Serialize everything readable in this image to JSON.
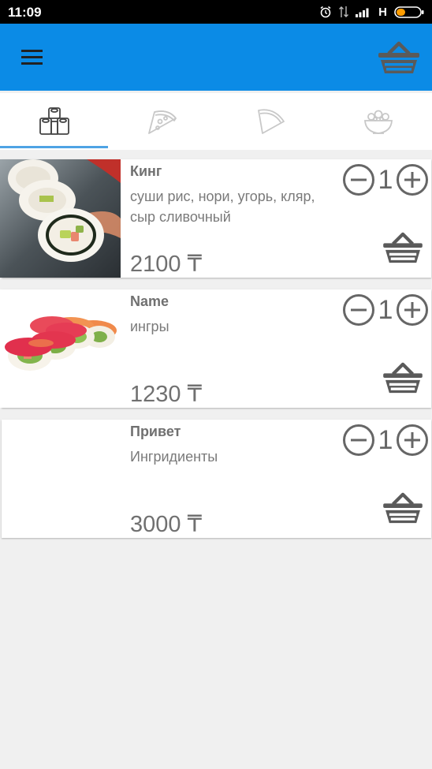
{
  "status_bar": {
    "time": "11:09",
    "network": "H",
    "icons": [
      "alarm-icon",
      "data-transfer-icon",
      "signal-icon",
      "battery-icon"
    ]
  },
  "app_bar": {
    "color": "#0b8be6",
    "menu_icon": "hamburger-menu-icon",
    "cart_icon": "basket-icon"
  },
  "tabs": [
    {
      "icon": "sushi-rolls-icon",
      "selected": true
    },
    {
      "icon": "pizza-slice-icon",
      "selected": false
    },
    {
      "icon": "pie-slice-icon",
      "selected": false
    },
    {
      "icon": "salad-bowl-icon",
      "selected": false
    }
  ],
  "products": [
    {
      "name": "Кинг",
      "description": "суши рис, нори, угорь, кляр, сыр сливочный",
      "price": "2100 ₸",
      "quantity": "1",
      "image": "sushi-roll-photo"
    },
    {
      "name": "Name",
      "description": "ингры",
      "price": "1230 ₸",
      "quantity": "1",
      "image": "sushi-set-photo"
    },
    {
      "name": "Привет",
      "description": "Ингридиенты",
      "price": "3000 ₸",
      "quantity": "1",
      "image": "none"
    }
  ]
}
